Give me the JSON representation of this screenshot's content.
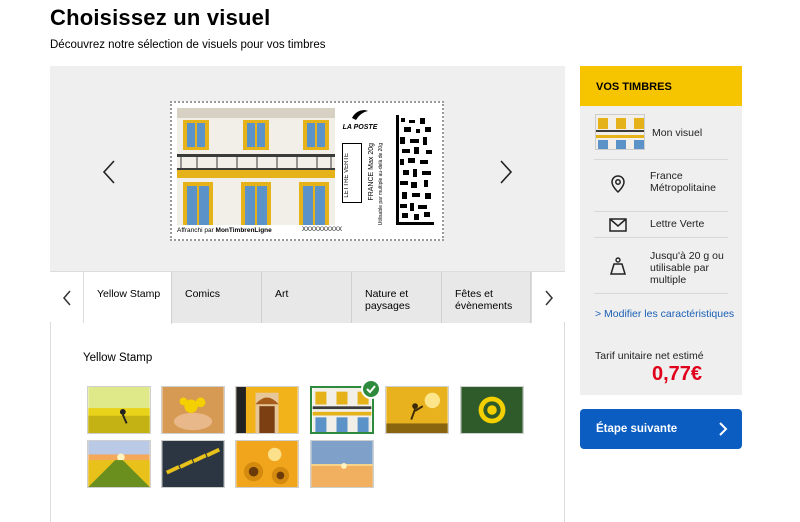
{
  "header": {
    "title": "Choisissez un visuel",
    "subtitle": "Découvrez notre sélection de visuels pour vos timbres"
  },
  "stamp": {
    "logo_text": "LA POSTE",
    "lettre_label": "LETTRE VERTE",
    "max_text": "FRANCE Max 20g",
    "max_sub": "Utilisable par multiple au-delà de 20g",
    "affranchi_prefix": "Affranchi par ",
    "affranchi_brand": "MonTimbrenLigne",
    "serial": "XXXXXXXXXX"
  },
  "tabs": [
    {
      "label": "Yellow Stamp",
      "active": true
    },
    {
      "label": "Comics",
      "active": false
    },
    {
      "label": "Art",
      "active": false
    },
    {
      "label": "Nature et paysages",
      "active": false
    },
    {
      "label": "Fêtes et évènements",
      "active": false
    }
  ],
  "gallery": {
    "title": "Yellow Stamp",
    "selected_index": 3,
    "thumbnails": [
      "tulip-field-cyclist",
      "hands-yellow-flowers",
      "yellow-doors-window",
      "yellow-facade-balcony",
      "jumping-silhouette-sunset",
      "yellow-target-on-grass",
      "tulip-field-sunrise",
      "yellow-crosswalk",
      "sunflowers-sunset",
      "sunset-over-sea"
    ]
  },
  "sidebar": {
    "header": "VOS TIMBRES",
    "visual_label": "Mon visuel",
    "destination": "France Métropolitaine",
    "letter_type": "Lettre Verte",
    "weight": "Jusqu'à 20 g ou utilisable par multiple",
    "modify_link": "> Modifier les caractéristiques",
    "tarif_label": "Tarif unitaire net estimé",
    "price": "0,77€"
  },
  "actions": {
    "next_step": "Étape suivante"
  },
  "colors": {
    "accent_yellow": "#f7c400",
    "primary_blue": "#0b5dc2",
    "price_red": "#e0001a",
    "selected_green": "#2e8b3d"
  }
}
